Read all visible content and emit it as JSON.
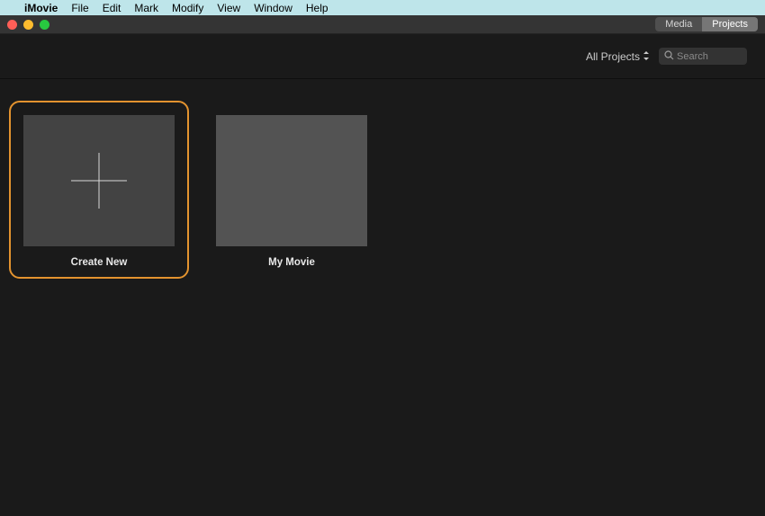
{
  "menu": {
    "app_name": "iMovie",
    "items": [
      "File",
      "Edit",
      "Mark",
      "Modify",
      "View",
      "Window",
      "Help"
    ]
  },
  "segmented": {
    "media": "Media",
    "projects": "Projects"
  },
  "toolbar": {
    "filter_label": "All Projects",
    "search_placeholder": "Search"
  },
  "tiles": {
    "create_new": "Create New",
    "project1": "My Movie"
  }
}
